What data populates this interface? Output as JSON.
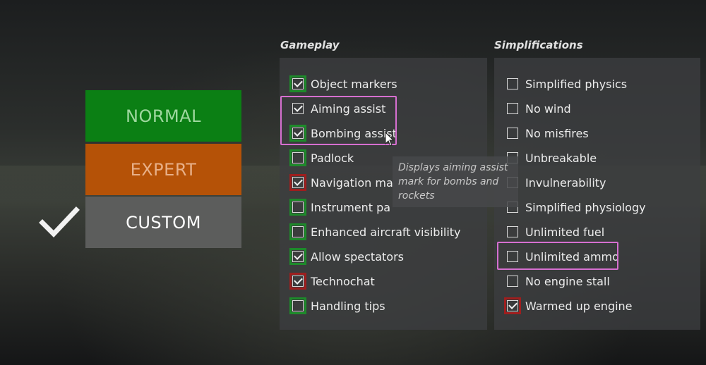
{
  "difficulty": {
    "normal_label": "NORMAL",
    "expert_label": "EXPERT",
    "custom_label": "CUSTOM",
    "selected": "CUSTOM",
    "colors": {
      "normal": "#0b7f14",
      "expert": "#b55207",
      "custom": "#5c5d5c"
    }
  },
  "gameplay": {
    "title": "Gameplay",
    "options": [
      {
        "label": "Object markers",
        "checked": true,
        "frame": "green"
      },
      {
        "label": "Aiming assist",
        "checked": true,
        "frame": "none"
      },
      {
        "label": "Bombing assist",
        "checked": true,
        "frame": "green"
      },
      {
        "label": "Padlock",
        "checked": false,
        "frame": "green"
      },
      {
        "label": "Navigation ma",
        "checked": true,
        "frame": "red"
      },
      {
        "label": "Instrument pa",
        "checked": false,
        "frame": "green"
      },
      {
        "label": "Enhanced aircraft visibility",
        "checked": false,
        "frame": "green"
      },
      {
        "label": "Allow spectators",
        "checked": true,
        "frame": "green"
      },
      {
        "label": "Technochat",
        "checked": true,
        "frame": "red"
      },
      {
        "label": "Handling tips",
        "checked": false,
        "frame": "green"
      }
    ]
  },
  "simplifications": {
    "title": "Simplifications",
    "options": [
      {
        "label": "Simplified physics",
        "checked": false,
        "frame": "none"
      },
      {
        "label": "No wind",
        "checked": false,
        "frame": "none"
      },
      {
        "label": "No misfires",
        "checked": false,
        "frame": "none"
      },
      {
        "label": "Unbreakable",
        "checked": false,
        "frame": "none"
      },
      {
        "label": "Invulnerability",
        "checked": false,
        "frame": "none"
      },
      {
        "label": "Simplified physiology",
        "checked": false,
        "frame": "none"
      },
      {
        "label": "Unlimited fuel",
        "checked": false,
        "frame": "none"
      },
      {
        "label": "Unlimited ammo",
        "checked": false,
        "frame": "none"
      },
      {
        "label": "No engine stall",
        "checked": false,
        "frame": "none"
      },
      {
        "label": "Warmed up engine",
        "checked": true,
        "frame": "red"
      }
    ]
  },
  "tooltip": {
    "line1": "Displays aiming assist",
    "line2": "mark for bombs and",
    "line3": "rockets"
  },
  "icons": {
    "selected_check": "checkmark-icon",
    "cursor": "mouse-cursor-icon"
  }
}
